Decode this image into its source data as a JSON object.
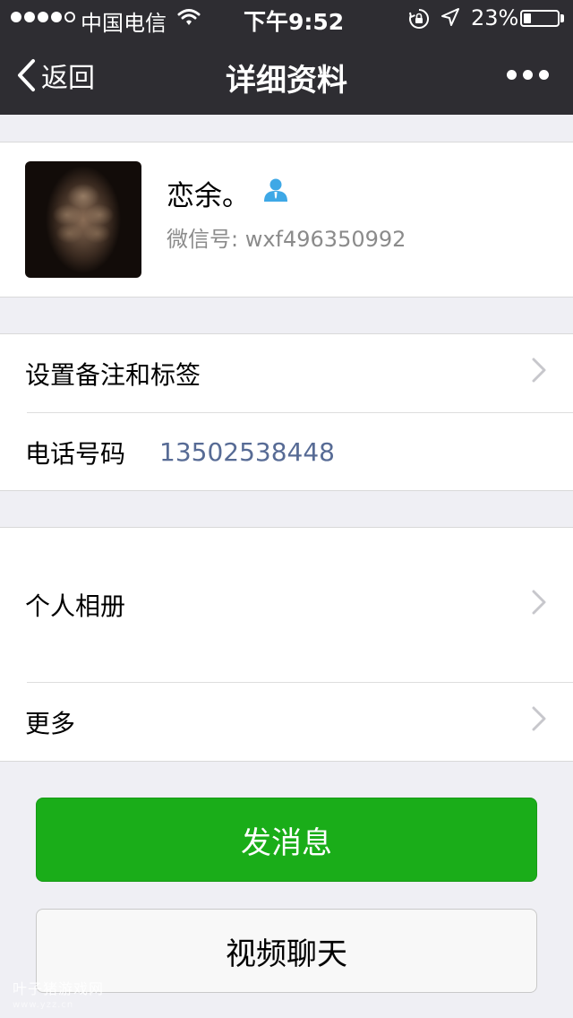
{
  "status_bar": {
    "carrier": "中国电信",
    "time": "下午9:52",
    "battery": "23%",
    "battery_level": 0.23
  },
  "nav": {
    "back_label": "返回",
    "title": "详细资料"
  },
  "profile": {
    "nickname": "恋余。",
    "wechat_id": "微信号: wxf496350992"
  },
  "info": {
    "remark_label": "设置备注和标签",
    "phone_label": "电话号码",
    "phone_value": "13502538448"
  },
  "media": {
    "album_label": "个人相册",
    "more_label": "更多"
  },
  "actions": {
    "message_label": "发消息",
    "video_label": "视频聊天"
  },
  "watermark": {
    "text": "叶子猪游戏网",
    "sub": "www.yzz.cn"
  },
  "colors": {
    "nav_bg": "#2e2d32",
    "page_bg": "#efeff4",
    "primary_button": "#1aad19",
    "link_blue": "#576b95",
    "person_icon": "#3ea8e6"
  },
  "icons": [
    "signal-dots-icon",
    "wifi-icon",
    "rotation-lock-icon",
    "location-arrow-icon",
    "battery-icon",
    "back-chevron-icon",
    "more-dots-icon",
    "person-icon",
    "chevron-right-icon"
  ]
}
